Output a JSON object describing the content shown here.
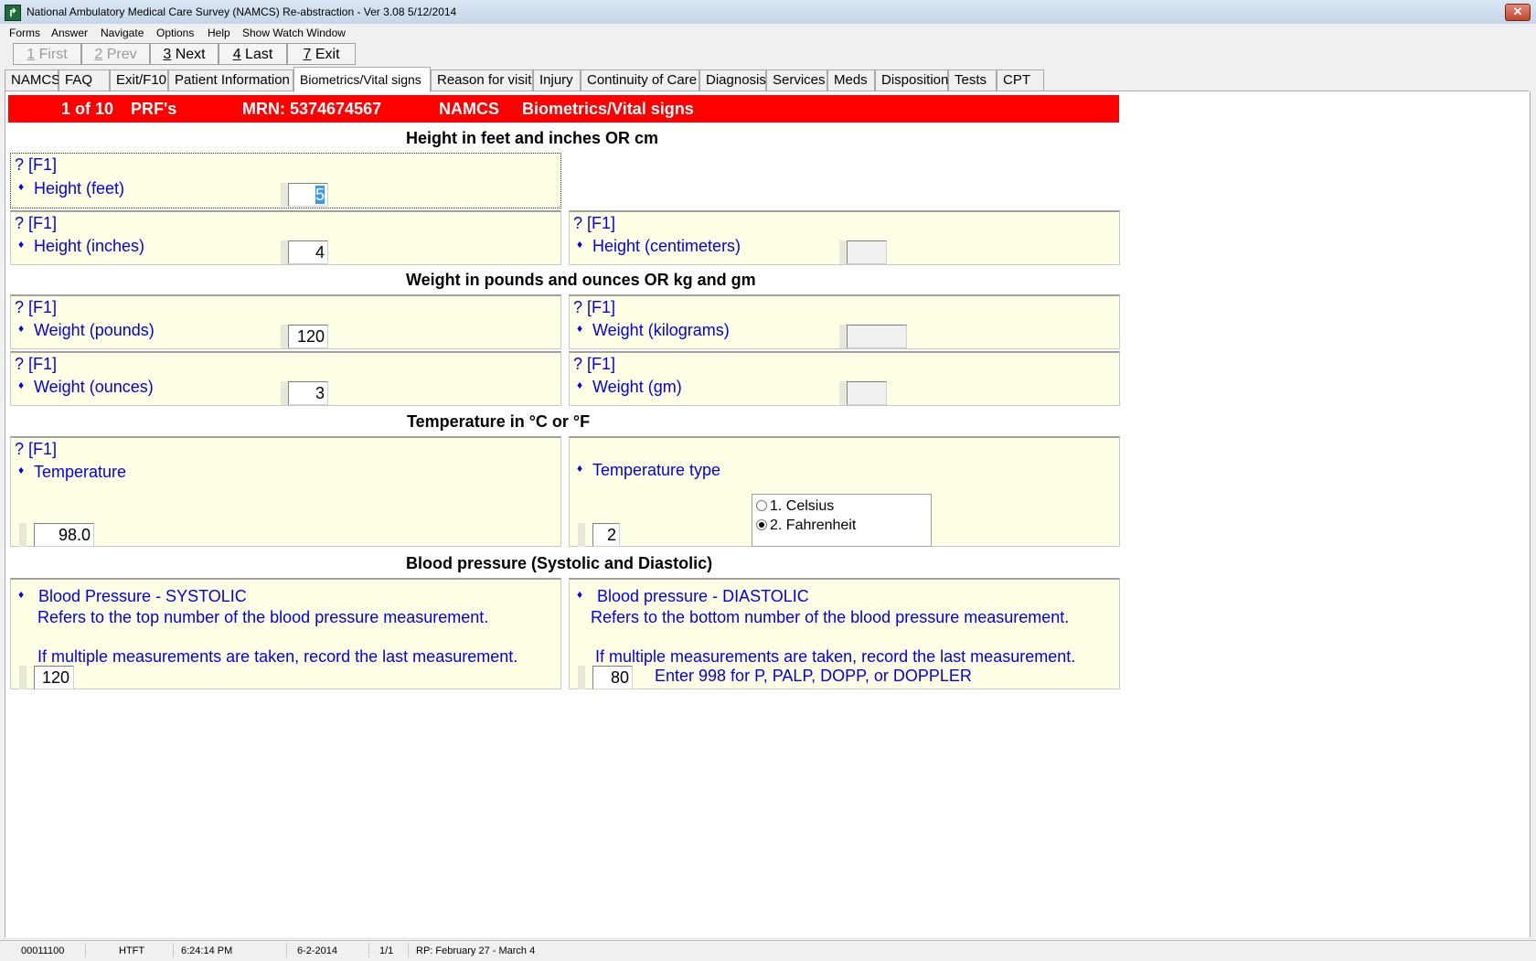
{
  "window": {
    "title": "National Ambulatory Medical Care Survey (NAMCS) Re-abstraction  - Ver 3.08 5/12/2014",
    "close": "✕"
  },
  "menu": [
    "Forms",
    "Answer",
    "Navigate",
    "Options",
    "Help",
    "Show Watch Window"
  ],
  "nav": [
    {
      "key": "1",
      "label": " First",
      "enabled": false
    },
    {
      "key": "2",
      "label": " Prev",
      "enabled": false
    },
    {
      "key": "3",
      "label": " Next",
      "enabled": true
    },
    {
      "key": "4",
      "label": " Last",
      "enabled": true
    },
    {
      "key": "7",
      "label": " Exit",
      "enabled": true
    }
  ],
  "tabs": [
    "NAMCS",
    "FAQ",
    "Exit/F10",
    "Patient Information",
    "Biometrics/Vital signs",
    "Reason for visit",
    "Injury",
    "Continuity of Care",
    "Diagnosis",
    "Services",
    "Meds",
    "Disposition",
    "Tests",
    "CPT"
  ],
  "active_tab": "Biometrics/Vital signs",
  "header": {
    "record": "1 of 10",
    "form": "PRF's",
    "mrn": "MRN: 5374674567",
    "survey": "NAMCS",
    "section": "Biometrics/Vital signs"
  },
  "help_marker": "? [F1]",
  "bullet": "♦",
  "sections": {
    "height": "Height in feet and inches OR cm",
    "weight": "Weight in pounds and ounces OR kg and gm",
    "temperature": "Temperature in °C or °F",
    "bp": "Blood pressure (Systolic and Diastolic)"
  },
  "fields": {
    "height_feet": {
      "label": "Height (feet)",
      "value": "5"
    },
    "height_inches": {
      "label": "Height (inches)",
      "value": "4"
    },
    "height_cm": {
      "label": "Height (centimeters)",
      "value": ""
    },
    "weight_pounds": {
      "label": "Weight (pounds)",
      "value": "120"
    },
    "weight_kg": {
      "label": "Weight (kilograms)",
      "value": ""
    },
    "weight_ounces": {
      "label": "Weight (ounces)",
      "value": "3"
    },
    "weight_gm": {
      "label": "Weight (gm)",
      "value": ""
    },
    "temperature": {
      "label": "Temperature",
      "value": "98.0"
    },
    "temperature_type": {
      "label": "Temperature type",
      "value": "2",
      "options": [
        "1.  Celsius",
        "2.  Fahrenheit"
      ],
      "selected_index": 1
    },
    "bp_systolic": {
      "label": "Blood Pressure - SYSTOLIC",
      "note1": "Refers to the top number of the blood pressure measurement.",
      "note2": "If multiple measurements are taken, record the last measurement.",
      "value": "120"
    },
    "bp_diastolic": {
      "label": "Blood pressure - DIASTOLIC",
      "note1": "Refers to the bottom number of the blood pressure measurement.",
      "note2": "If multiple measurements are taken, record the last measurement.",
      "value": "80",
      "hint": "Enter 998 for P, PALP, DOPP, or DOPPLER"
    }
  },
  "status": {
    "id": "00011100",
    "user": "HTFT",
    "time": "6:24:14 PM",
    "date": "6-2-2014",
    "page": "1/1",
    "rp": "RP: February 27 - March 4"
  }
}
